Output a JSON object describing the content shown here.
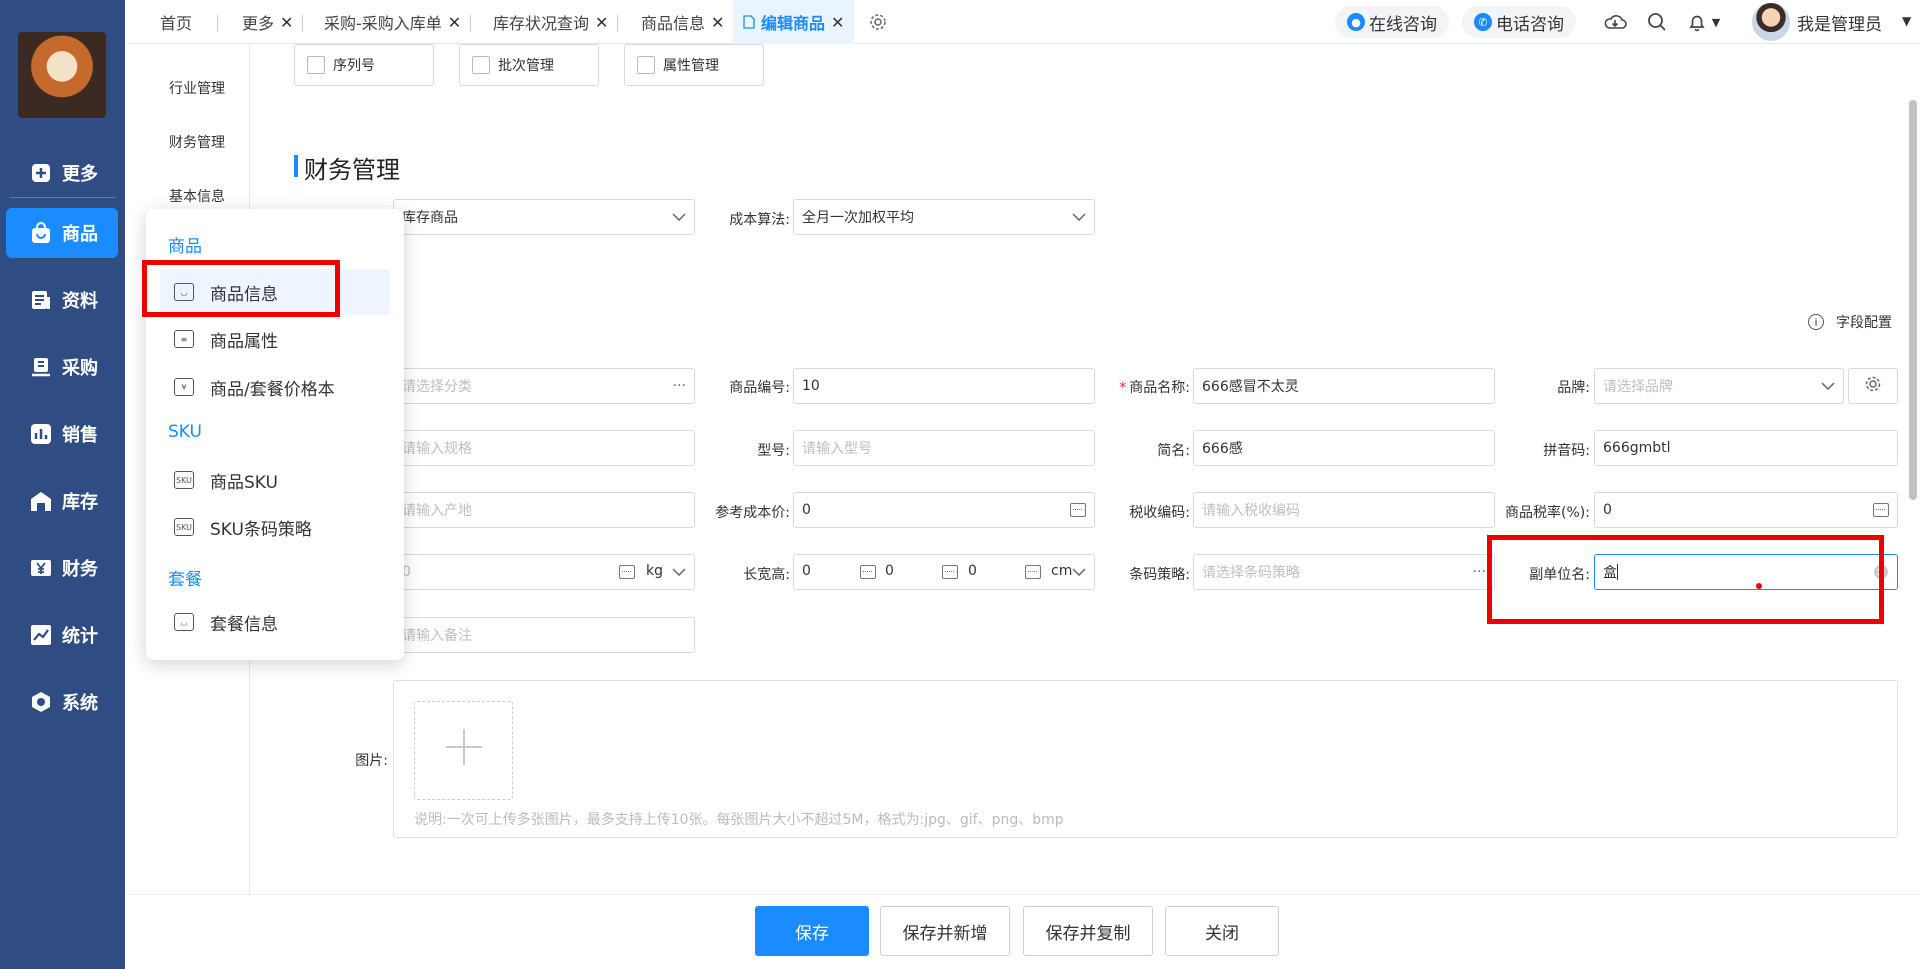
{
  "sidebar": {
    "items": [
      {
        "label": "更多",
        "icon": "plus-square-icon"
      },
      {
        "label": "商品",
        "icon": "shopping-bag-icon",
        "active": true
      },
      {
        "label": "资料",
        "icon": "document-icon"
      },
      {
        "label": "采购",
        "icon": "purchase-icon"
      },
      {
        "label": "销售",
        "icon": "bar-chart-icon"
      },
      {
        "label": "库存",
        "icon": "warehouse-icon"
      },
      {
        "label": "财务",
        "icon": "yen-icon"
      },
      {
        "label": "统计",
        "icon": "trend-chart-icon"
      },
      {
        "label": "系统",
        "icon": "hexagon-gear-icon"
      }
    ]
  },
  "subcol": {
    "items": [
      "行业管理",
      "财务管理",
      "基本信息"
    ]
  },
  "tabs": [
    {
      "label": "首页"
    },
    {
      "label": "更多"
    },
    {
      "label": "采购-采购入库单"
    },
    {
      "label": "库存状况查询"
    },
    {
      "label": "商品信息"
    },
    {
      "label": "编辑商品"
    }
  ],
  "tab_close": "✕",
  "header": {
    "online_consult": "在线咨询",
    "phone_consult": "电话咨询",
    "user_name": "我是管理员",
    "caret": "▼"
  },
  "checkboxes": [
    "序列号",
    "批次管理",
    "属性管理"
  ],
  "section": {
    "title": "财务管理"
  },
  "finance": {
    "type_value": "库存商品",
    "cost_label": "成本算法:",
    "cost_value": "全月一次加权平均"
  },
  "field_config": "字段配置",
  "form": {
    "category_placeholder": "请选择分类",
    "code_label": "商品编号:",
    "code_value": "10",
    "name_label": "商品名称:",
    "name_value": "666感冒不太灵",
    "brand_label": "品牌:",
    "brand_placeholder": "请选择品牌",
    "spec_placeholder": "请输入规格",
    "model_label": "型号:",
    "model_placeholder": "请输入型号",
    "short_label": "简名:",
    "short_value": "666感",
    "pinyin_label": "拼音码:",
    "pinyin_value": "666gmbtl",
    "origin_placeholder": "请输入产地",
    "refcost_label": "参考成本价:",
    "refcost_value": "0",
    "taxcode_label": "税收编码:",
    "taxcode_placeholder": "请输入税收编码",
    "taxrate_label": "商品税率(%):",
    "taxrate_value": "0",
    "weight_value": "0",
    "weight_unit": "kg",
    "lwh_label": "长宽高:",
    "length_value": "0",
    "width_value": "0",
    "height_value": "0",
    "lwh_unit": "cm",
    "barcode_label": "条码策略:",
    "barcode_placeholder": "请选择条码策略",
    "subunit_label": "副单位名:",
    "subunit_value": "盒",
    "remark_placeholder": "请输入备注",
    "image_label": "图片:",
    "upload_hint": "说明:一次可上传多张图片，最多支持上传10张。每张图片大小不超过5M，格式为:jpg、gif、png、bmp"
  },
  "buttons": {
    "save": "保存",
    "save_new": "保存并新增",
    "save_copy": "保存并复制",
    "close": "关闭"
  },
  "popover": {
    "group_goods": "商品",
    "goods_items": [
      "商品信息",
      "商品属性",
      "商品/套餐价格本"
    ],
    "group_sku": "SKU",
    "sku_items": [
      "商品SKU",
      "SKU条码策略"
    ],
    "group_combo": "套餐",
    "combo_items": [
      "套餐信息"
    ]
  },
  "colors": {
    "sidebar_bg": "#2f4d82",
    "accent": "#1a8cff",
    "highlight_red": "#ee0000"
  }
}
